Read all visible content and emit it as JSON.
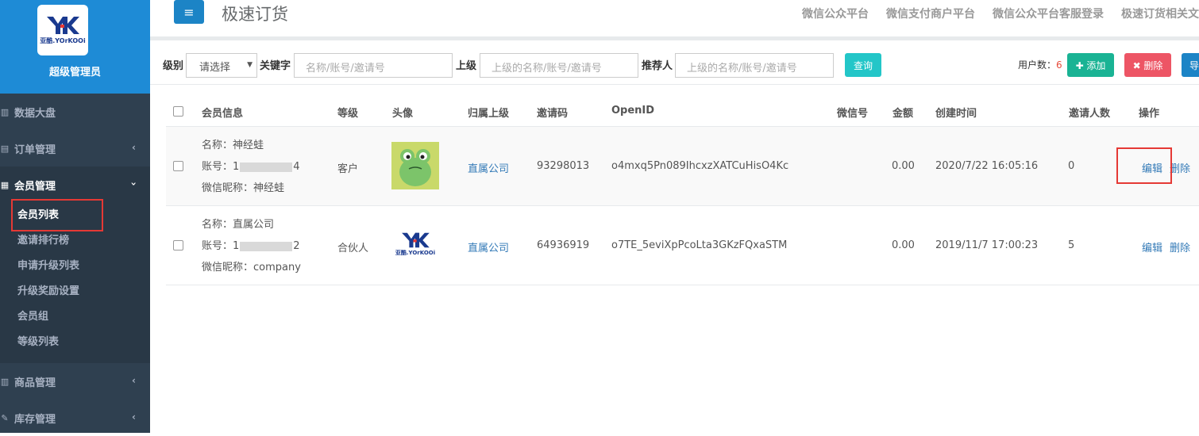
{
  "sidebar": {
    "admin_name": "超级管理员",
    "logo_text": "亚酷.YOrKOOi",
    "items": [
      {
        "label": "数据大盘",
        "icon": "chart-icon"
      },
      {
        "label": "订单管理",
        "icon": "list-icon",
        "chevron": "‹"
      },
      {
        "label": "会员管理",
        "icon": "users-icon",
        "chevron": "›"
      },
      {
        "label": "商品管理",
        "icon": "chart-icon",
        "chevron": "‹"
      },
      {
        "label": "库存管理",
        "icon": "edit-icon",
        "chevron": "‹"
      }
    ],
    "subitems": [
      "会员列表",
      "邀请排行榜",
      "申请升级列表",
      "升级奖励设置",
      "会员组",
      "等级列表"
    ]
  },
  "topbar": {
    "menu_icon": "≡",
    "title": "极速订货",
    "links": [
      "微信公众平台",
      "微信支付商户平台",
      "微信公众平台客服登录",
      "极速订货相关文"
    ]
  },
  "filter": {
    "level_label": "级别",
    "level_select": "请选择",
    "keyword_label": "关键字",
    "keyword_placeholder": "名称/账号/邀请号",
    "parent_label": "上级",
    "parent_placeholder": "上级的名称/账号/邀请号",
    "referrer_label": "推荐人",
    "referrer_placeholder": "上级的名称/账号/邀请号",
    "query_button": "查询",
    "count_label": "用户数：",
    "count_value": "6",
    "add_button": "✚ 添加",
    "delete_button": "✖ 删除",
    "export_button": "导"
  },
  "table": {
    "headers": [
      "会员信息",
      "等级",
      "头像",
      "归属上级",
      "邀请码",
      "OpenID",
      "微信号",
      "金额",
      "创建时间",
      "邀请人数",
      "操作"
    ],
    "rows": [
      {
        "name_label": "名称：",
        "name": "神经蛙",
        "account_label": "账号：",
        "account_prefix": "1",
        "account_suffix": "4",
        "nick_label": "微信昵称：",
        "nickname": "神经蛙",
        "level": "客户",
        "parent": "直属公司",
        "invite_code": "93298013",
        "openid": "o4mxq5Pn089IhcxzXATCuHisO4Kc",
        "wechat": "",
        "amount": "0.00",
        "created": "2020/7/22 16:05:16",
        "invites": "0",
        "edit": "编辑",
        "delete": "删除"
      },
      {
        "name_label": "名称：",
        "name": "直属公司",
        "account_label": "账号：",
        "account_prefix": "1",
        "account_suffix": "2",
        "nick_label": "微信昵称：",
        "nickname": "company",
        "level": "合伙人",
        "parent": "直属公司",
        "invite_code": "64936919",
        "openid": "o7TE_5eviXpPcoLta3GKzFQxaSTM",
        "wechat": "",
        "amount": "0.00",
        "created": "2019/11/7 17:00:23",
        "invites": "5",
        "edit": "编辑",
        "delete": "删除"
      }
    ]
  },
  "colors": {
    "sidebar_bg": "#2f4050",
    "header_blue": "#1e8bd6",
    "add_green": "#1ab394",
    "delete_red": "#ed5565",
    "query_cyan": "#23c6c8",
    "highlight_red": "#e53935"
  }
}
